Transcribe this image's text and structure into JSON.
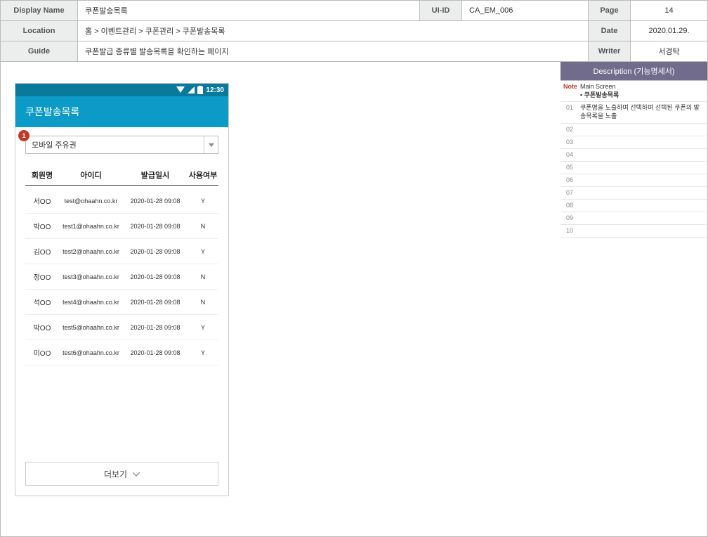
{
  "header": {
    "labels": {
      "display_name": "Display Name",
      "ui_id": "UI-ID",
      "page": "Page",
      "location": "Location",
      "date": "Date",
      "guide": "Guide",
      "writer": "Writer"
    },
    "display_name": "쿠폰발송목록",
    "ui_id": "CA_EM_006",
    "page": "14",
    "location": "홈 > 이벤트관리 > 쿠폰관리 > 쿠폰발송목록",
    "date": "2020.01.29.",
    "guide": "쿠폰발급 종류별 발송목록을 확인하는 페이지",
    "writer": "서경탁"
  },
  "description": {
    "title": "Description (기능명세서)",
    "note_label": "Note",
    "note_text_title": "Main Screen",
    "note_text_bullet": "• 쿠폰발송목록",
    "rows": {
      "r01": "쿠폰명을 노출하며 선택하며 선택된 쿠폰의 발송목록을 노출",
      "r02": "",
      "r03": "",
      "r04": "",
      "r05": "",
      "r06": "",
      "r07": "",
      "r08": "",
      "r09": "",
      "r10": ""
    },
    "nums": {
      "n01": "01",
      "n02": "02",
      "n03": "03",
      "n04": "04",
      "n05": "05",
      "n06": "06",
      "n07": "07",
      "n08": "08",
      "n09": "09",
      "n10": "10"
    }
  },
  "mock": {
    "status_time": "12:30",
    "appbar_title": "쿠폰발송목록",
    "callout": "1",
    "select_value": "모바일 주유권",
    "columns": {
      "name": "회원명",
      "id": "아이디",
      "date": "발급일시",
      "use": "사용여부"
    },
    "rows": [
      {
        "name": "서OO",
        "id": "test@ohaahn.co.kr",
        "date": "2020-01-28 09:08",
        "use": "Y"
      },
      {
        "name": "박OO",
        "id": "test1@ohaahn.co.kr",
        "date": "2020-01-28 09:08",
        "use": "N"
      },
      {
        "name": "김OO",
        "id": "test2@ohaahn.co.kr",
        "date": "2020-01-28 09:08",
        "use": "Y"
      },
      {
        "name": "정OO",
        "id": "test3@ohaahn.co.kr",
        "date": "2020-01-28 09:08",
        "use": "N"
      },
      {
        "name": "석OO",
        "id": "test4@ohaahn.co.kr",
        "date": "2020-01-28 09:08",
        "use": "N"
      },
      {
        "name": "박OO",
        "id": "test5@ohaahn.co.kr",
        "date": "2020-01-28 09:08",
        "use": "Y"
      },
      {
        "name": "미OO",
        "id": "test6@ohaahn.co.kr",
        "date": "2020-01-28 09:08",
        "use": "Y"
      }
    ],
    "more_label": "더보기"
  }
}
